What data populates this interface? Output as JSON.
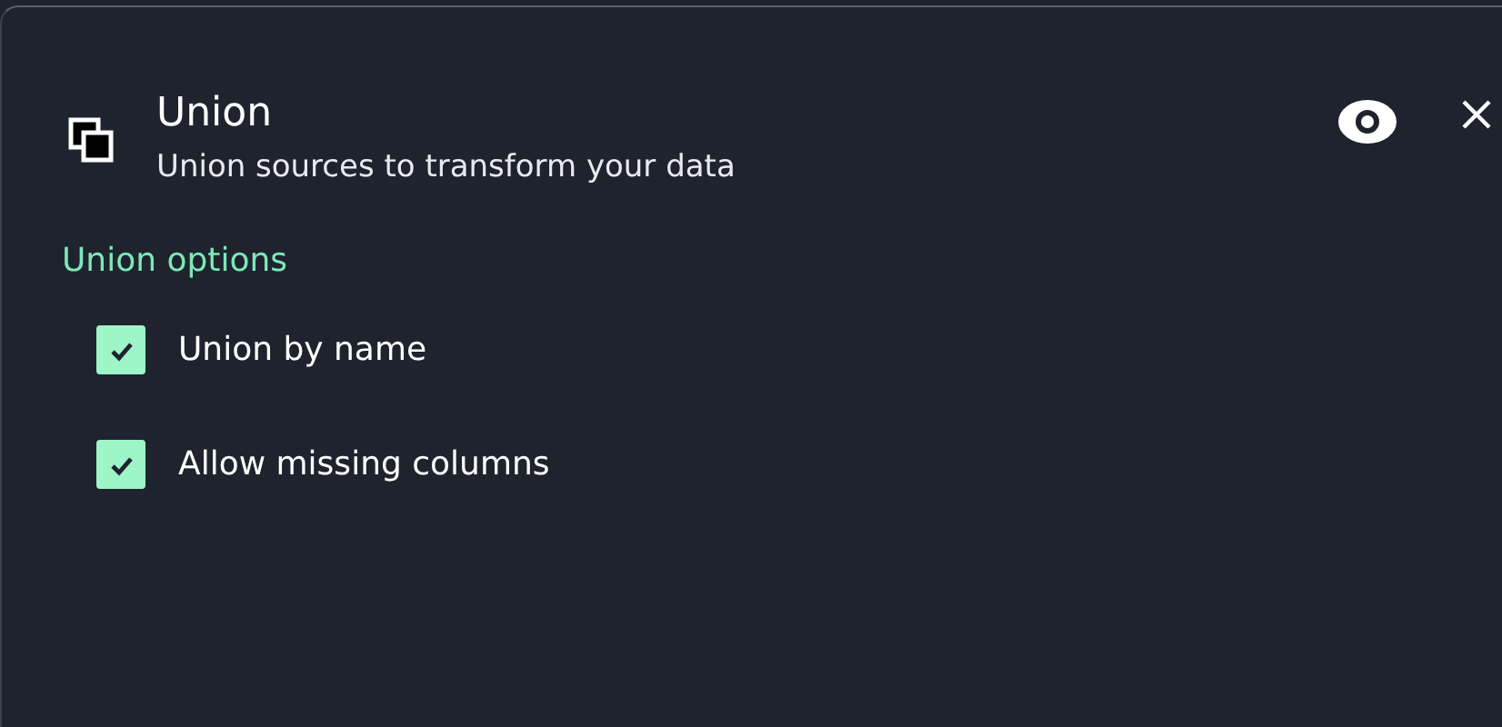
{
  "panel": {
    "title": "Union",
    "subtitle": "Union sources to transform your data"
  },
  "section": {
    "title": "Union options"
  },
  "options": [
    {
      "label": "Union by name",
      "checked": true
    },
    {
      "label": "Allow missing columns",
      "checked": true
    }
  ]
}
